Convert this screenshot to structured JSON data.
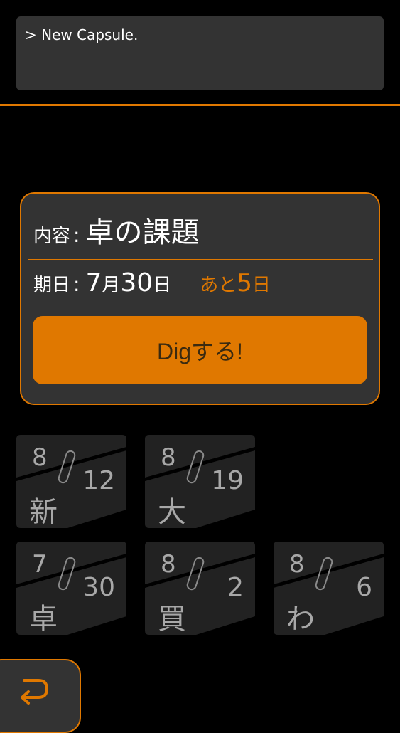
{
  "console": {
    "text": "> New Capsule."
  },
  "card": {
    "content_label": "内容",
    "separator": ":",
    "title": "卓の課題",
    "date_label": "期日",
    "due_month": "7",
    "month_unit": "月",
    "due_day": "30",
    "day_unit": "日",
    "remaining_prefix": "あと",
    "remaining_days": "5",
    "remaining_unit": "日",
    "dig_button_label": "Digする!"
  },
  "capsules": [
    {
      "month": "8",
      "day": "12",
      "char": "新"
    },
    {
      "month": "8",
      "day": "19",
      "char": "大"
    },
    {
      "month": "7",
      "day": "30",
      "char": "卓"
    },
    {
      "month": "8",
      "day": "2",
      "char": "買"
    },
    {
      "month": "8",
      "day": "6",
      "char": "わ"
    }
  ],
  "back_button": {
    "icon": "return-arrow-icon"
  },
  "colors": {
    "accent": "#e07800",
    "card_bg": "#333333",
    "tile_bg": "#222222",
    "background": "#000000"
  }
}
